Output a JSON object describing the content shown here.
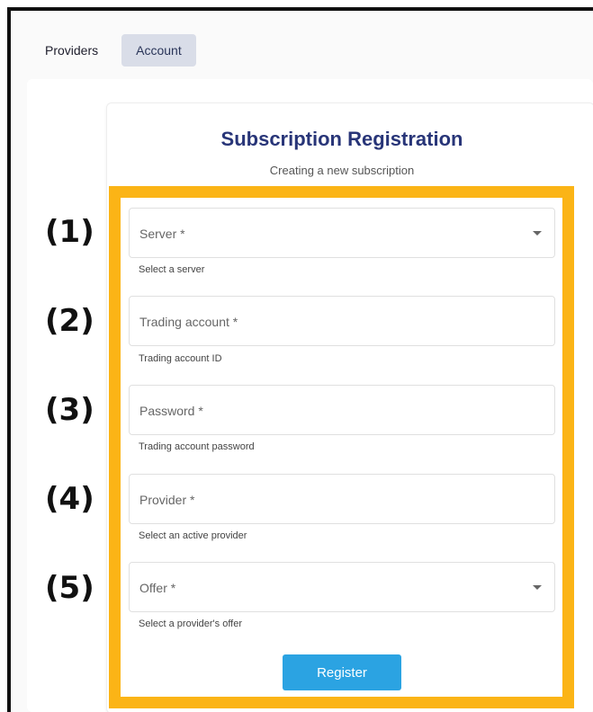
{
  "tabs": [
    {
      "label": "Providers"
    },
    {
      "label": "Account"
    }
  ],
  "form": {
    "title": "Subscription Registration",
    "subtitle": "Creating a new subscription",
    "fields": [
      {
        "label": "Server *",
        "helper": "Select a server",
        "type": "select"
      },
      {
        "label": "Trading account *",
        "helper": "Trading account ID",
        "type": "text"
      },
      {
        "label": "Password *",
        "helper": "Trading account password",
        "type": "password"
      },
      {
        "label": "Provider *",
        "helper": "Select an active provider",
        "type": "text"
      },
      {
        "label": "Offer *",
        "helper": "Select a provider's offer",
        "type": "select"
      }
    ],
    "submit_label": "Register"
  },
  "annotations": {
    "steps": [
      "(1)",
      "(2)",
      "(3)",
      "(4)",
      "(5)"
    ]
  },
  "colors": {
    "title": "#283578",
    "highlight_border": "#fbb416",
    "button": "#2ba3e2",
    "active_tab": "#d9dde8"
  }
}
